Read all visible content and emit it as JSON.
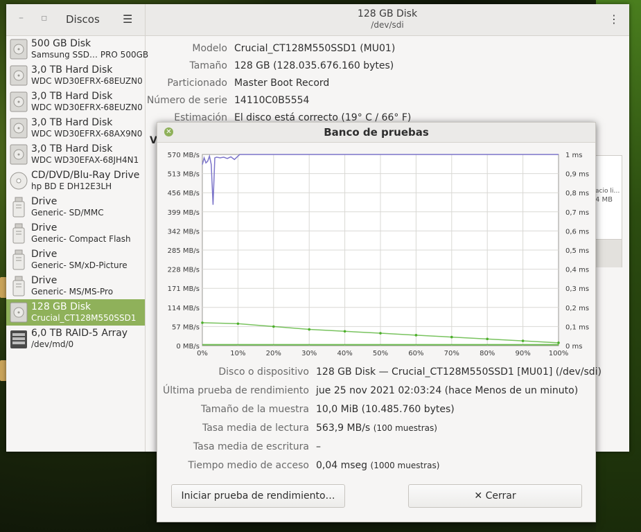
{
  "sidebar": {
    "title": "Discos",
    "items": [
      {
        "name": "500 GB Disk",
        "desc": "Samsung SSD… PRO 500GB",
        "icon": "hard-disk-icon"
      },
      {
        "name": "3,0 TB Hard Disk",
        "desc": "WDC WD30EFRX-68EUZN0",
        "icon": "hard-disk-icon"
      },
      {
        "name": "3,0 TB Hard Disk",
        "desc": "WDC WD30EFRX-68EUZN0",
        "icon": "hard-disk-icon"
      },
      {
        "name": "3,0 TB Hard Disk",
        "desc": "WDC WD30EFRX-68AX9N0",
        "icon": "hard-disk-icon"
      },
      {
        "name": "3,0 TB Hard Disk",
        "desc": "WDC WD30EFAX-68JH4N1",
        "icon": "hard-disk-icon"
      },
      {
        "name": "CD/DVD/Blu-Ray Drive",
        "desc": "hp    BD  E  DH12E3LH",
        "icon": "optical-drive-icon"
      },
      {
        "name": "Drive",
        "desc": "Generic- SD/MMC",
        "icon": "usb-drive-icon"
      },
      {
        "name": "Drive",
        "desc": "Generic- Compact Flash",
        "icon": "usb-drive-icon"
      },
      {
        "name": "Drive",
        "desc": "Generic- SM/xD-Picture",
        "icon": "usb-drive-icon"
      },
      {
        "name": "Drive",
        "desc": "Generic- MS/MS-Pro",
        "icon": "usb-drive-icon"
      },
      {
        "name": "128 GB Disk",
        "desc": "Crucial_CT128M550SSD1",
        "icon": "hard-disk-icon",
        "selected": true
      },
      {
        "name": "6,0 TB RAID-5 Array",
        "desc": "/dev/md/0",
        "icon": "raid-array-icon"
      }
    ]
  },
  "header": {
    "title": "128 GB Disk",
    "subtitle": "/dev/sdi"
  },
  "properties": [
    {
      "label": "Modelo",
      "value": "Crucial_CT128M550SSD1 (MU01)"
    },
    {
      "label": "Tamaño",
      "value": "128 GB (128.035.676.160 bytes)"
    },
    {
      "label": "Particionado",
      "value": "Master Boot Record"
    },
    {
      "label": "Número de serie",
      "value": "14110C0B5554"
    },
    {
      "label": "Estimación",
      "value": "El disco está correcto (19° C / 66° F)"
    }
  ],
  "volumes_fragment": {
    "heading_char": "V",
    "line1": "acio li…",
    "line2": "4 MB"
  },
  "dialog": {
    "title": "Banco de pruebas",
    "rows": [
      {
        "label": "Disco o dispositivo",
        "value": "128 GB Disk — Crucial_CT128M550SSD1 [MU01] (/dev/sdi)",
        "note": ""
      },
      {
        "label": "Última prueba de rendimiento",
        "value": "jue 25 nov 2021 02:03:24 (hace Menos de un minuto)",
        "note": ""
      },
      {
        "label": "Tamaño de la muestra",
        "value": "10,0 MiB (10.485.760 bytes)",
        "note": ""
      },
      {
        "label": "Tasa media de lectura",
        "value": "563,9 MB/s",
        "note": "(100 muestras)"
      },
      {
        "label": "Tasa media de escritura",
        "value": "–",
        "note": ""
      },
      {
        "label": "Tiempo medio de acceso",
        "value": "0,04 mseg",
        "note": "(1000 muestras)"
      }
    ],
    "start_button": "Iniciar prueba de rendimiento…",
    "close_button": "Cerrar"
  },
  "chart_data": {
    "type": "line",
    "x_ticks": [
      "0%",
      "10%",
      "20%",
      "30%",
      "40%",
      "50%",
      "60%",
      "70%",
      "80%",
      "90%",
      "100%"
    ],
    "y_left_ticks": [
      "0 MB/s",
      "57 MB/s",
      "114 MB/s",
      "171 MB/s",
      "228 MB/s",
      "285 MB/s",
      "342 MB/s",
      "399 MB/s",
      "456 MB/s",
      "513 MB/s",
      "570 MB/s"
    ],
    "y_right_ticks": [
      "0 ms",
      "0,1 ms",
      "0,2 ms",
      "0,3 ms",
      "0,4 ms",
      "0,5 ms",
      "0,6 ms",
      "0,7 ms",
      "0,8 ms",
      "0,9 ms",
      "1 ms"
    ],
    "xlim": [
      0,
      100
    ],
    "ylim_left": [
      0,
      570
    ],
    "ylim_right": [
      0,
      1
    ],
    "grid": true,
    "colors": {
      "read": "#7b74c9",
      "access": "#4caf2a"
    },
    "series": [
      {
        "axis": "left",
        "x": [
          0,
          0.5,
          1,
          1.5,
          2,
          2.5,
          3,
          3.5,
          4,
          5,
          6,
          7,
          8,
          9,
          10,
          10.5,
          11,
          100
        ],
        "values": [
          540,
          560,
          545,
          550,
          565,
          540,
          420,
          560,
          562,
          560,
          562,
          558,
          563,
          555,
          565,
          570,
          570,
          570
        ]
      },
      {
        "axis": "right",
        "x": [
          0,
          10,
          20,
          30,
          40,
          50,
          60,
          70,
          80,
          90,
          100
        ],
        "values": [
          0.12,
          0.115,
          0.1,
          0.085,
          0.075,
          0.065,
          0.055,
          0.045,
          0.035,
          0.025,
          0.015
        ]
      }
    ]
  }
}
